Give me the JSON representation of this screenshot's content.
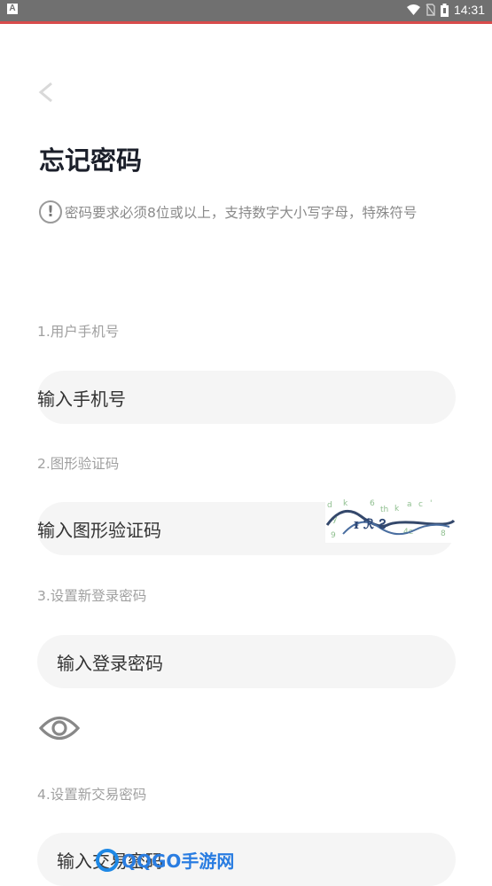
{
  "status_bar": {
    "app_letter": "A",
    "time": "14:31"
  },
  "page": {
    "title": "忘记密码",
    "tip_icon_glyph": "!",
    "tip": "密码要求必须8位或以上，支持数字大小写字母，特殊符号"
  },
  "form": {
    "phone_label": "1.用户手机号",
    "phone_placeholder": "输入手机号",
    "captcha_label": "2.图形验证码",
    "captcha_placeholder": "输入图形验证码",
    "login_pwd_label": "3.设置新登录密码",
    "login_pwd_placeholder": "输入登录密码",
    "trade_pwd_label": "4.设置新交易密码",
    "trade_pwd_placeholder": "输入交易密码"
  },
  "watermark": {
    "text": "QQGO手游网"
  },
  "colors": {
    "status_bar": "#707070",
    "accent_line": "#d84b4b",
    "field_bg": "#f5f5f5",
    "title": "#1b1f2a",
    "label": "#a0a0a0"
  }
}
